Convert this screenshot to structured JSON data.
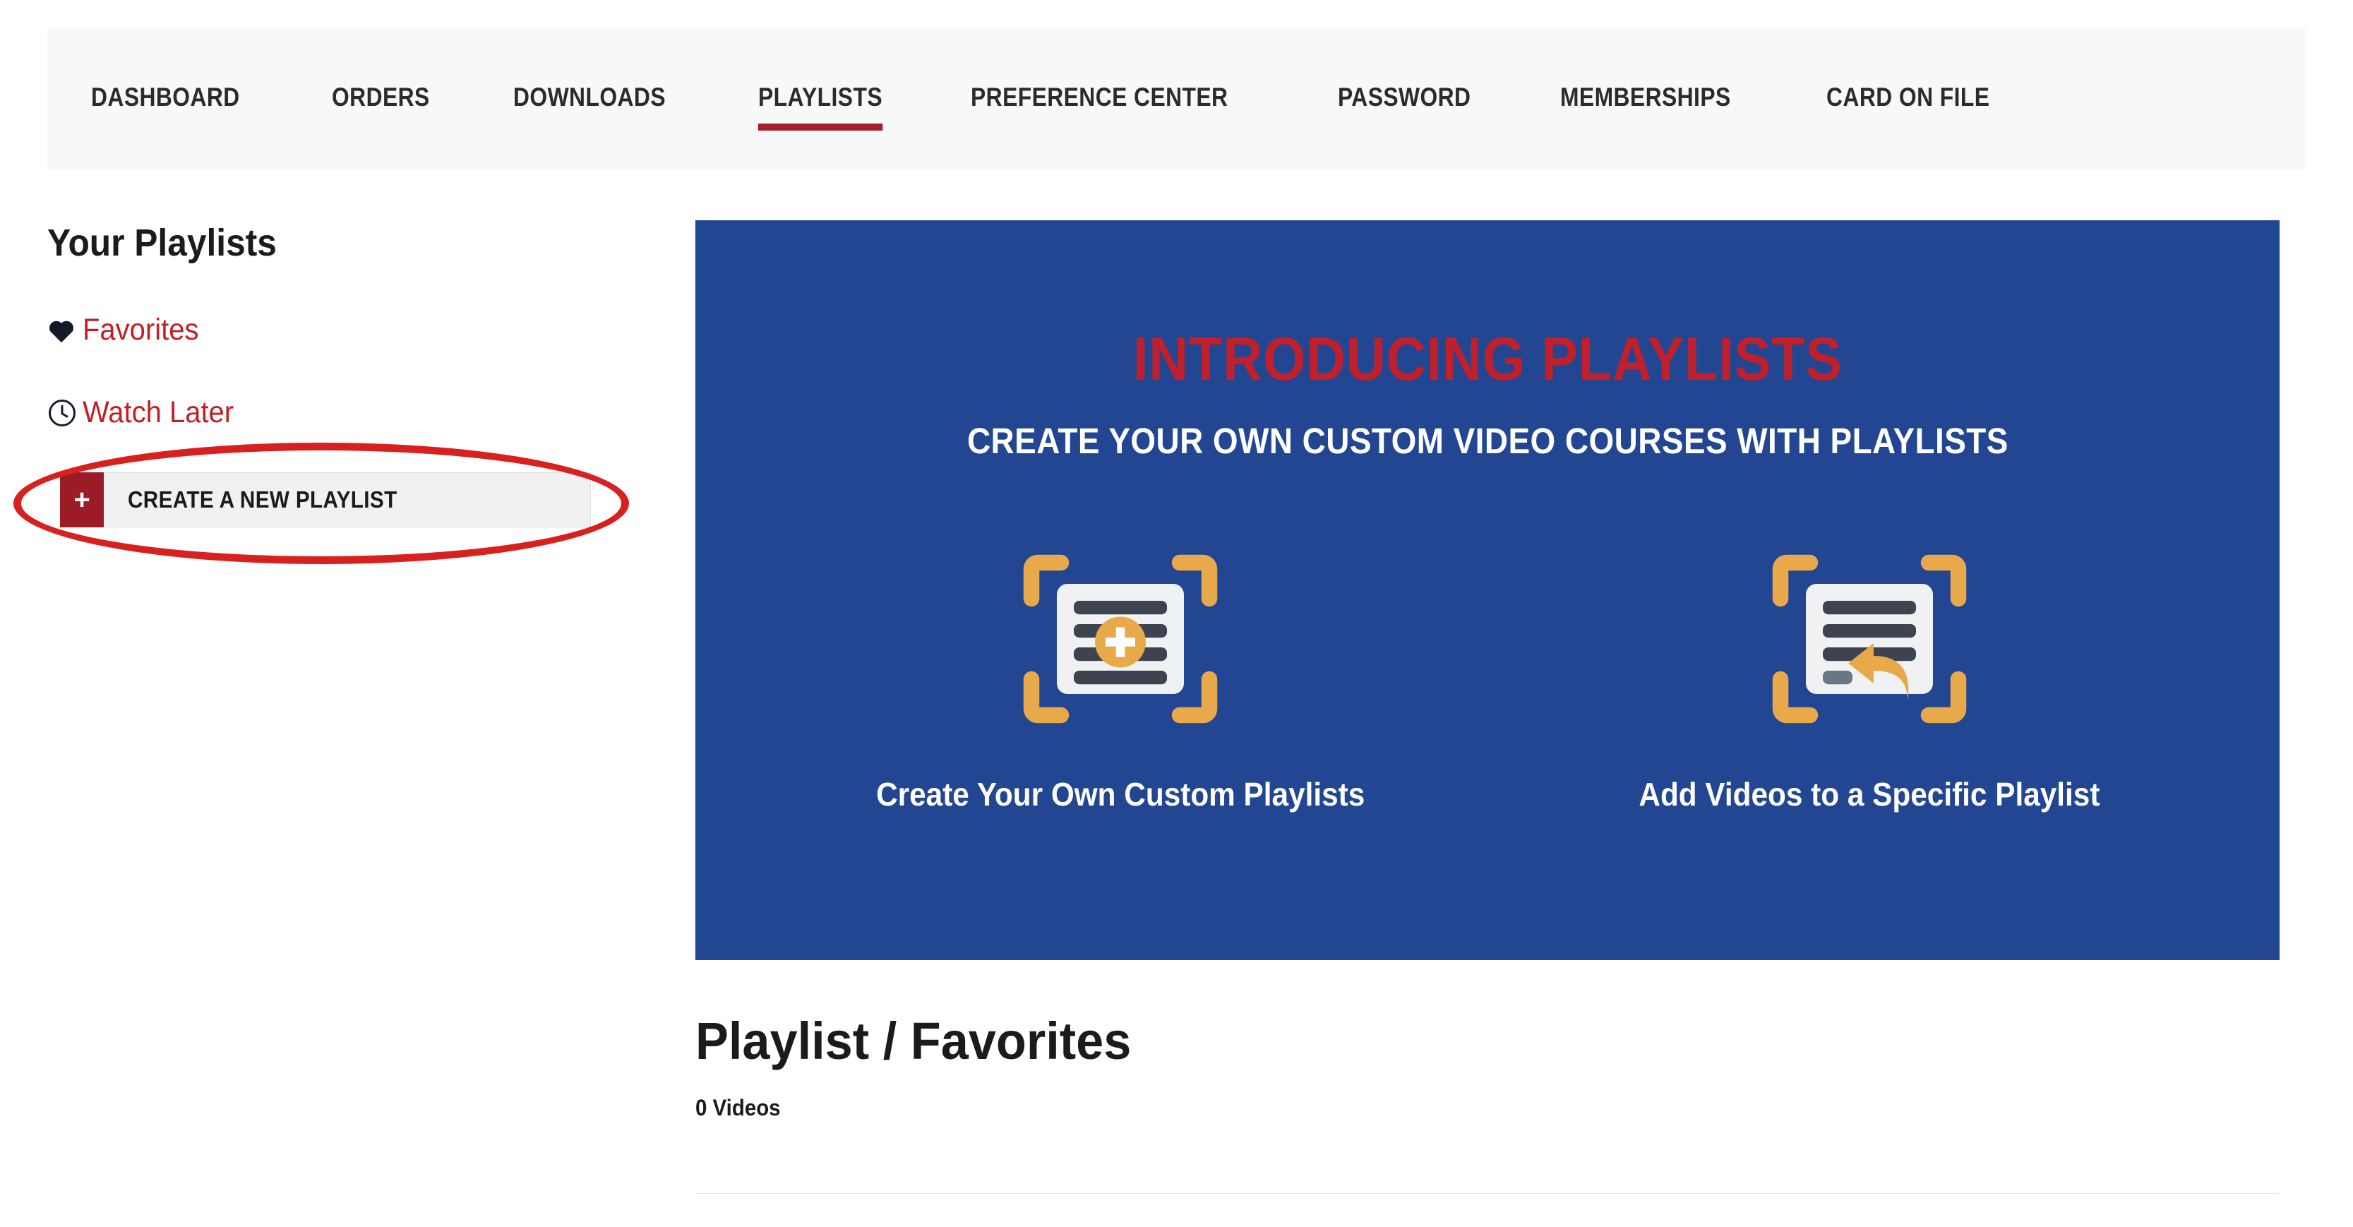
{
  "nav": {
    "items": [
      {
        "label": "DASHBOARD",
        "active": false
      },
      {
        "label": "ORDERS",
        "active": false
      },
      {
        "label": "DOWNLOADS",
        "active": false
      },
      {
        "label": "PLAYLISTS",
        "active": true
      },
      {
        "label": "PREFERENCE CENTER",
        "active": false
      },
      {
        "label": "PASSWORD",
        "active": false
      },
      {
        "label": "MEMBERSHIPS",
        "active": false
      },
      {
        "label": "CARD ON FILE",
        "active": false
      }
    ]
  },
  "sidebar": {
    "title": "Your Playlists",
    "links": [
      {
        "label": "Favorites",
        "icon": "heart-icon"
      },
      {
        "label": "Watch Later",
        "icon": "clock-icon"
      }
    ],
    "create_button": {
      "label": "CREATE A NEW PLAYLIST",
      "plus": "+"
    }
  },
  "banner": {
    "title": "INTRODUCING PLAYLISTS",
    "subtitle": "CREATE YOUR OWN CUSTOM VIDEO COURSES WITH PLAYLISTS",
    "cards": [
      {
        "caption": "Create Your Own Custom Playlists",
        "icon": "playlist-add-icon"
      },
      {
        "caption": "Add Videos to a Specific Playlist",
        "icon": "playlist-reply-icon"
      }
    ]
  },
  "playlist_header": {
    "prefix": "Playlist / ",
    "name": "Favorites",
    "count": "0 Videos"
  },
  "colors": {
    "nav_background": "#f7f8f8",
    "accent_red": "#bf2026",
    "active_underline": "#a71d2a",
    "banner_blue": "#224692",
    "banner_title_red": "#c0202c",
    "icon_orange": "#e8a94b",
    "icon_dark": "#3d4450",
    "annotation_red": "#d8201f",
    "create_plus_bg": "#9b1c26"
  }
}
